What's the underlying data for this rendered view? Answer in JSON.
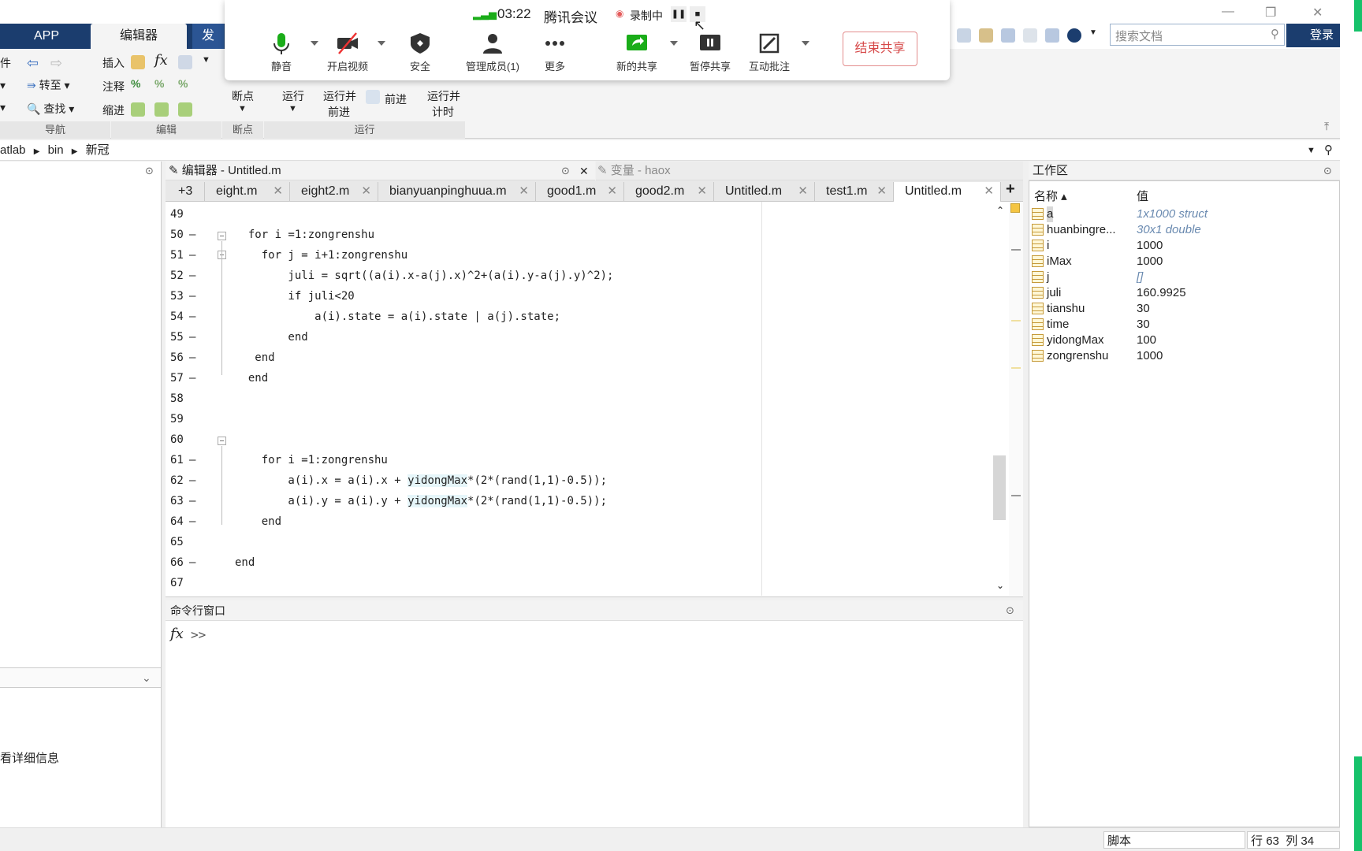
{
  "toptabs": {
    "app": "APP",
    "editor": "编辑器",
    "publish_partial": "发"
  },
  "ribbon": {
    "file_partial": "件",
    "insert": "插入",
    "comment": "注释",
    "indent": "缩进",
    "goto": "转至",
    "find": "查找",
    "breakpoints": "断点",
    "run": "运行",
    "run_advance_1": "运行并",
    "run_advance_2": "前进",
    "advance": "前进",
    "run_time_1": "运行并",
    "run_time_2": "计时",
    "group_nav": "导航",
    "group_edit": "编辑",
    "group_bp": "断点",
    "group_run": "运行"
  },
  "meeting": {
    "time": "03:22",
    "title": "腾讯会议",
    "recording": "录制中",
    "mute": "静音",
    "video": "开启视频",
    "security": "安全",
    "members": "管理成员(1)",
    "more": "更多",
    "new_share": "新的共享",
    "pause_share": "暂停共享",
    "annotate": "互动批注",
    "end_share": "结束共享"
  },
  "search": {
    "placeholder": "搜索文档",
    "login": "登录"
  },
  "path": {
    "seg1": "atlab",
    "seg2": "bin",
    "seg3": "新冠"
  },
  "left": {
    "detail": "看详细信息"
  },
  "editor": {
    "title": "编辑器 - Untitled.m",
    "var_title": "变量 - haox",
    "more_tabs": "+3",
    "tabs": [
      "eight.m",
      "eight2.m",
      "bianyuanpinghuua.m",
      "good1.m",
      "good2.m",
      "Untitled.m",
      "test1.m",
      "Untitled.m"
    ],
    "lines": [
      {
        "n": "49",
        "dash": "",
        "code": ""
      },
      {
        "n": "50",
        "dash": "—",
        "code": "  for i =1:zongrenshu"
      },
      {
        "n": "51",
        "dash": "—",
        "code": "    for j = i+1:zongrenshu"
      },
      {
        "n": "52",
        "dash": "—",
        "code": "        juli = sqrt((a(i).x-a(j).x)^2+(a(i).y-a(j).y)^2);"
      },
      {
        "n": "53",
        "dash": "—",
        "code": "        if juli<20"
      },
      {
        "n": "54",
        "dash": "—",
        "code": "            a(i).state = a(i).state | a(j).state;"
      },
      {
        "n": "55",
        "dash": "—",
        "code": "        end"
      },
      {
        "n": "56",
        "dash": "—",
        "code": "   end"
      },
      {
        "n": "57",
        "dash": "—",
        "code": "  end"
      },
      {
        "n": "58",
        "dash": "",
        "code": ""
      },
      {
        "n": "59",
        "dash": "",
        "code": ""
      },
      {
        "n": "60",
        "dash": "",
        "code": ""
      },
      {
        "n": "61",
        "dash": "—",
        "code": "    for i =1:zongrenshu"
      },
      {
        "n": "62",
        "dash": "—",
        "code": "        a(i).x = a(i).x + yidongMax*(2*(rand(1,1)-0.5));"
      },
      {
        "n": "63",
        "dash": "—",
        "code": "        a(i).y = a(i).y + yidongMax*(2*(rand(1,1)-0.5));"
      },
      {
        "n": "64",
        "dash": "—",
        "code": "    end"
      },
      {
        "n": "65",
        "dash": "",
        "code": ""
      },
      {
        "n": "66",
        "dash": "—",
        "code": "end"
      },
      {
        "n": "67",
        "dash": "",
        "code": ""
      }
    ]
  },
  "cmd": {
    "title": "命令行窗口",
    "prompt": "fx >>"
  },
  "workspace": {
    "title": "工作区",
    "col_name": "名称 ▴",
    "col_value": "值",
    "vars": [
      {
        "name": "a",
        "value": "1x1000 struct"
      },
      {
        "name": "huanbingre...",
        "value": "30x1 double"
      },
      {
        "name": "i",
        "value": "1000"
      },
      {
        "name": "iMax",
        "value": "1000"
      },
      {
        "name": "j",
        "value": "[]"
      },
      {
        "name": "juli",
        "value": "160.9925"
      },
      {
        "name": "tianshu",
        "value": "30"
      },
      {
        "name": "time",
        "value": "30"
      },
      {
        "name": "yidongMax",
        "value": "100"
      },
      {
        "name": "zongrenshu",
        "value": "1000"
      }
    ]
  },
  "status": {
    "mode": "脚本",
    "row_label": "行",
    "row": "63",
    "col_label": "列",
    "col": "34"
  }
}
